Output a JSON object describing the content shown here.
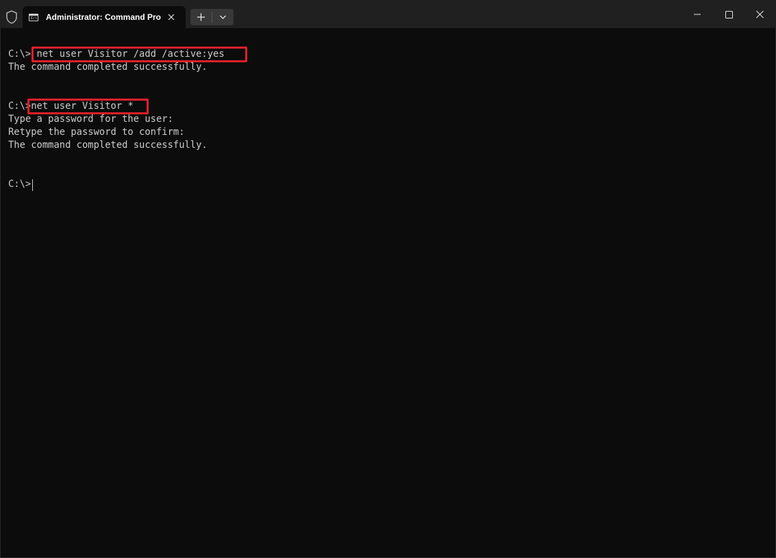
{
  "window": {
    "tab_title": "Administrator: Command Pro",
    "tab_icon_text": "C:\\"
  },
  "console": {
    "lines": [
      {
        "prompt": "C:\\>",
        "command": " net user Visitor /add /active:yes"
      },
      {
        "text": "The command completed successfully."
      },
      {
        "prompt": "C:\\>",
        "command": "net user Visitor *"
      },
      {
        "text": "Type a password for the user:"
      },
      {
        "text": "Retype the password to confirm:"
      },
      {
        "text": "The command completed successfully."
      },
      {
        "prompt": "C:\\>"
      }
    ]
  },
  "colors": {
    "background": "#0c0c0c",
    "titlebar": "#202020",
    "foreground": "#cccccc",
    "highlight": "#e0202a"
  },
  "icons": {
    "shield": "shield-icon",
    "tab": "terminal-icon",
    "tab_close": "close-icon",
    "new_tab": "plus-icon",
    "dropdown": "chevron-down-icon",
    "minimize": "minimize-icon",
    "maximize": "maximize-icon",
    "close": "close-icon"
  }
}
